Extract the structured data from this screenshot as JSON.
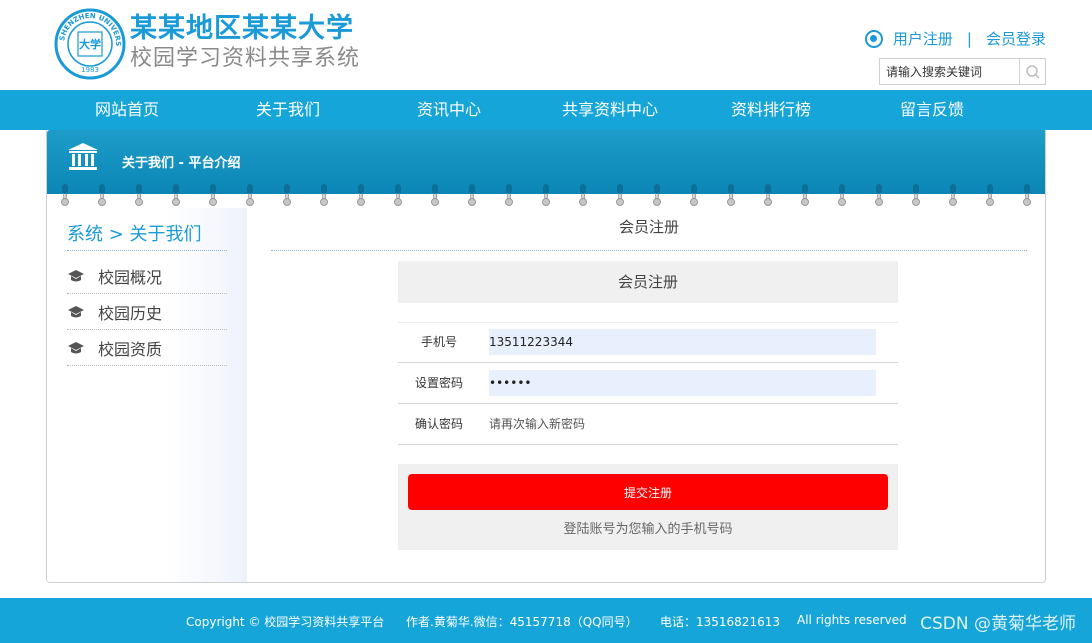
{
  "header": {
    "title": "某某地区某某大学",
    "subtitle": "校园学习资料共享系统",
    "logo_ring_text": "SHENZHEN UNIVERSITY",
    "logo_center_text": "大学",
    "logo_year": "1983",
    "register_link": "用户注册",
    "separator": "|",
    "login_link": "会员登录",
    "search_placeholder": "请输入搜索关键词"
  },
  "nav": {
    "items": [
      {
        "label": "网站首页"
      },
      {
        "label": "关于我们"
      },
      {
        "label": "资讯中心"
      },
      {
        "label": "共享资料中心"
      },
      {
        "label": "资料排行榜"
      },
      {
        "label": "留言反馈"
      }
    ]
  },
  "banner": {
    "title": "关于我们 - 平台介绍"
  },
  "sidebar": {
    "title": "系统 > 关于我们",
    "items": [
      {
        "label": "校园概况"
      },
      {
        "label": "校园历史"
      },
      {
        "label": "校园资质"
      }
    ]
  },
  "content": {
    "title": "会员注册",
    "form_heading": "会员注册",
    "fields": [
      {
        "label": "手机号",
        "value": "13511223344",
        "placeholder": ""
      },
      {
        "label": "设置密码",
        "value": "••••••",
        "placeholder": ""
      },
      {
        "label": "确认密码",
        "value": "",
        "placeholder": "请再次输入新密码"
      }
    ],
    "submit_label": "提交注册",
    "note": "登陆账号为您输入的手机号码"
  },
  "footer": {
    "copyright": "Copyright © 校园学习资料共享平台",
    "author": "作者.黄菊华.微信：45157718（QQ同号）",
    "phone": "电话：13516821613",
    "rights": "All rights reserved",
    "watermark": "CSDN @黄菊华老师"
  },
  "colors": {
    "brand_blue": "#16a5d8",
    "submit_red": "#ff0000",
    "title_blue": "#1a9ad6"
  },
  "icons": {
    "radio": "radio-selected-icon",
    "search": "search-icon",
    "banner": "building-icon",
    "sidebar_bullet": "graduation-cap-icon"
  }
}
